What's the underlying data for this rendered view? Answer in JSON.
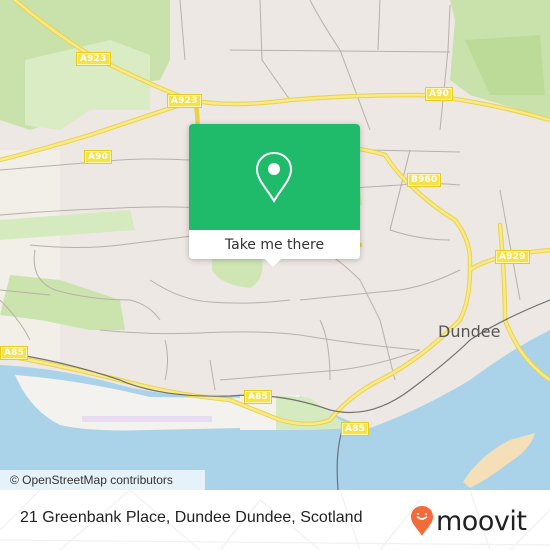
{
  "map": {
    "colors": {
      "land": "#ede8e4",
      "water": "#aad3ea",
      "park": "#cfe6b4",
      "wood": "#c1dea0",
      "road_major": "#f7e36b",
      "road_minor": "#b8b0ab",
      "sand": "#f4dfb9",
      "railway": "#707070"
    },
    "road_labels": [
      {
        "id": "a923-north",
        "text": "A923"
      },
      {
        "id": "a923-mid",
        "text": "A923"
      },
      {
        "id": "a90-west",
        "text": "A90"
      },
      {
        "id": "a90-east",
        "text": "A90"
      },
      {
        "id": "b960",
        "text": "B960"
      },
      {
        "id": "a929",
        "text": "A929"
      },
      {
        "id": "a85-west",
        "text": "A85"
      },
      {
        "id": "a85-mid",
        "text": "A85"
      },
      {
        "id": "a85-east",
        "text": "A85"
      }
    ],
    "place_labels": [
      {
        "id": "dundee",
        "text": "Dundee"
      }
    ],
    "attribution": "© OpenStreetMap contributors"
  },
  "popup": {
    "icon": "map-pin-icon",
    "button_label": "Take me there",
    "color": "#1fba6a"
  },
  "footer": {
    "address": "21 Greenbank Place, Dundee Dundee, Scotland",
    "brand": "moovit",
    "brand_color": "#f26b3a"
  }
}
